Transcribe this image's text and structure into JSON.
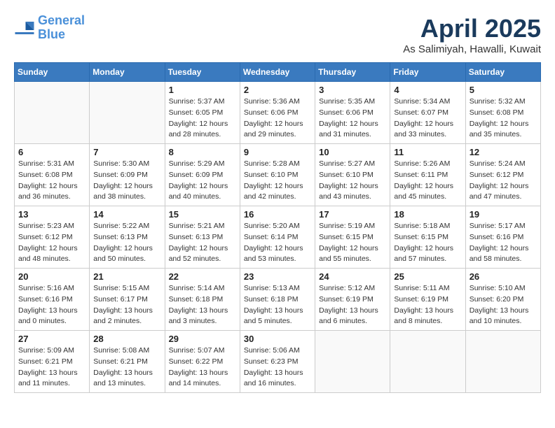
{
  "header": {
    "logo_line1": "General",
    "logo_line2": "Blue",
    "month_title": "April 2025",
    "location": "As Salimiyah, Hawalli, Kuwait"
  },
  "weekdays": [
    "Sunday",
    "Monday",
    "Tuesday",
    "Wednesday",
    "Thursday",
    "Friday",
    "Saturday"
  ],
  "weeks": [
    [
      {
        "day": "",
        "info": ""
      },
      {
        "day": "",
        "info": ""
      },
      {
        "day": "1",
        "info": "Sunrise: 5:37 AM\nSunset: 6:05 PM\nDaylight: 12 hours and 28 minutes."
      },
      {
        "day": "2",
        "info": "Sunrise: 5:36 AM\nSunset: 6:06 PM\nDaylight: 12 hours and 29 minutes."
      },
      {
        "day": "3",
        "info": "Sunrise: 5:35 AM\nSunset: 6:06 PM\nDaylight: 12 hours and 31 minutes."
      },
      {
        "day": "4",
        "info": "Sunrise: 5:34 AM\nSunset: 6:07 PM\nDaylight: 12 hours and 33 minutes."
      },
      {
        "day": "5",
        "info": "Sunrise: 5:32 AM\nSunset: 6:08 PM\nDaylight: 12 hours and 35 minutes."
      }
    ],
    [
      {
        "day": "6",
        "info": "Sunrise: 5:31 AM\nSunset: 6:08 PM\nDaylight: 12 hours and 36 minutes."
      },
      {
        "day": "7",
        "info": "Sunrise: 5:30 AM\nSunset: 6:09 PM\nDaylight: 12 hours and 38 minutes."
      },
      {
        "day": "8",
        "info": "Sunrise: 5:29 AM\nSunset: 6:09 PM\nDaylight: 12 hours and 40 minutes."
      },
      {
        "day": "9",
        "info": "Sunrise: 5:28 AM\nSunset: 6:10 PM\nDaylight: 12 hours and 42 minutes."
      },
      {
        "day": "10",
        "info": "Sunrise: 5:27 AM\nSunset: 6:10 PM\nDaylight: 12 hours and 43 minutes."
      },
      {
        "day": "11",
        "info": "Sunrise: 5:26 AM\nSunset: 6:11 PM\nDaylight: 12 hours and 45 minutes."
      },
      {
        "day": "12",
        "info": "Sunrise: 5:24 AM\nSunset: 6:12 PM\nDaylight: 12 hours and 47 minutes."
      }
    ],
    [
      {
        "day": "13",
        "info": "Sunrise: 5:23 AM\nSunset: 6:12 PM\nDaylight: 12 hours and 48 minutes."
      },
      {
        "day": "14",
        "info": "Sunrise: 5:22 AM\nSunset: 6:13 PM\nDaylight: 12 hours and 50 minutes."
      },
      {
        "day": "15",
        "info": "Sunrise: 5:21 AM\nSunset: 6:13 PM\nDaylight: 12 hours and 52 minutes."
      },
      {
        "day": "16",
        "info": "Sunrise: 5:20 AM\nSunset: 6:14 PM\nDaylight: 12 hours and 53 minutes."
      },
      {
        "day": "17",
        "info": "Sunrise: 5:19 AM\nSunset: 6:15 PM\nDaylight: 12 hours and 55 minutes."
      },
      {
        "day": "18",
        "info": "Sunrise: 5:18 AM\nSunset: 6:15 PM\nDaylight: 12 hours and 57 minutes."
      },
      {
        "day": "19",
        "info": "Sunrise: 5:17 AM\nSunset: 6:16 PM\nDaylight: 12 hours and 58 minutes."
      }
    ],
    [
      {
        "day": "20",
        "info": "Sunrise: 5:16 AM\nSunset: 6:16 PM\nDaylight: 13 hours and 0 minutes."
      },
      {
        "day": "21",
        "info": "Sunrise: 5:15 AM\nSunset: 6:17 PM\nDaylight: 13 hours and 2 minutes."
      },
      {
        "day": "22",
        "info": "Sunrise: 5:14 AM\nSunset: 6:18 PM\nDaylight: 13 hours and 3 minutes."
      },
      {
        "day": "23",
        "info": "Sunrise: 5:13 AM\nSunset: 6:18 PM\nDaylight: 13 hours and 5 minutes."
      },
      {
        "day": "24",
        "info": "Sunrise: 5:12 AM\nSunset: 6:19 PM\nDaylight: 13 hours and 6 minutes."
      },
      {
        "day": "25",
        "info": "Sunrise: 5:11 AM\nSunset: 6:19 PM\nDaylight: 13 hours and 8 minutes."
      },
      {
        "day": "26",
        "info": "Sunrise: 5:10 AM\nSunset: 6:20 PM\nDaylight: 13 hours and 10 minutes."
      }
    ],
    [
      {
        "day": "27",
        "info": "Sunrise: 5:09 AM\nSunset: 6:21 PM\nDaylight: 13 hours and 11 minutes."
      },
      {
        "day": "28",
        "info": "Sunrise: 5:08 AM\nSunset: 6:21 PM\nDaylight: 13 hours and 13 minutes."
      },
      {
        "day": "29",
        "info": "Sunrise: 5:07 AM\nSunset: 6:22 PM\nDaylight: 13 hours and 14 minutes."
      },
      {
        "day": "30",
        "info": "Sunrise: 5:06 AM\nSunset: 6:23 PM\nDaylight: 13 hours and 16 minutes."
      },
      {
        "day": "",
        "info": ""
      },
      {
        "day": "",
        "info": ""
      },
      {
        "day": "",
        "info": ""
      }
    ]
  ]
}
